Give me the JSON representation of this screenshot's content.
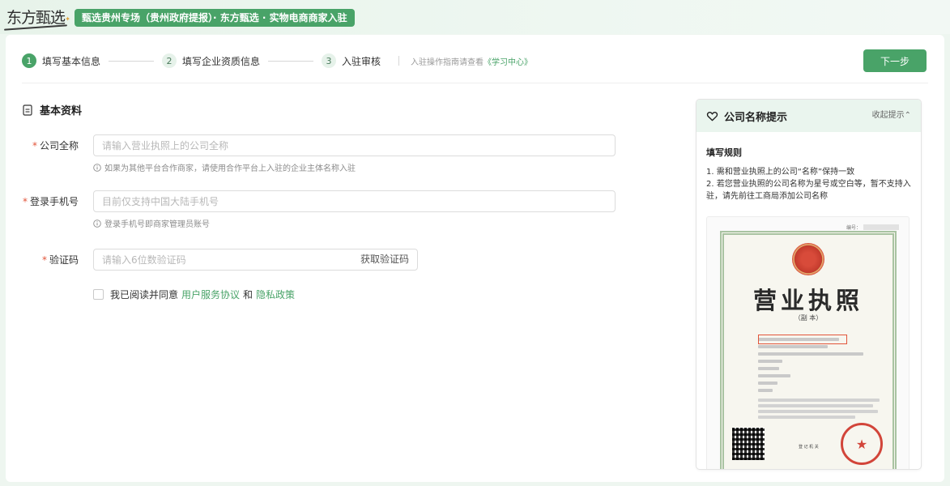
{
  "header": {
    "logo_text": "东方甄选",
    "banner": "甄选贵州专场（贵州政府提报）· 东方甄选 · 实物电商商家入驻"
  },
  "steps": [
    {
      "num": "1",
      "label": "填写基本信息"
    },
    {
      "num": "2",
      "label": "填写企业资质信息"
    },
    {
      "num": "3",
      "label": "入驻审核"
    }
  ],
  "guide": {
    "prefix": "入驻操作指南请查看",
    "link": "《学习中心》"
  },
  "next_button": "下一步",
  "section_title": "基本资料",
  "form": {
    "company": {
      "label": "公司全称",
      "placeholder": "请输入营业执照上的公司全称",
      "hint": "如果为其他平台合作商家，请使用合作平台上入驻的企业主体名称入驻"
    },
    "phone": {
      "label": "登录手机号",
      "placeholder": "目前仅支持中国大陆手机号",
      "hint": "登录手机号即商家管理员账号"
    },
    "code": {
      "label": "验证码",
      "placeholder": "请输入6位数验证码",
      "get_code": "获取验证码"
    },
    "required_mark": "*"
  },
  "agreement": {
    "prefix": "我已阅读并同意",
    "terms_link": "用户服务协议",
    "and": "和",
    "privacy_link": "隐私政策"
  },
  "panel": {
    "title": "公司名称提示",
    "collapse": "收起提示⌃",
    "rules_title": "填写规则",
    "rule_1": "1. 需和营业执照上的公司“名称”保持一致",
    "rule_2": "2. 若您营业执照的公司名称为星号或空白等，暂不支持入驻，请先前往工商局添加公司名称",
    "license": {
      "number_label": "编号：",
      "title": "营业执照",
      "subtitle": "（副  本）",
      "seal_glyph": "★",
      "reg_org": "登 记 机 关"
    }
  },
  "colors": {
    "accent": "#49a368",
    "required": "#e2553a",
    "highlight": "#e2553a"
  }
}
